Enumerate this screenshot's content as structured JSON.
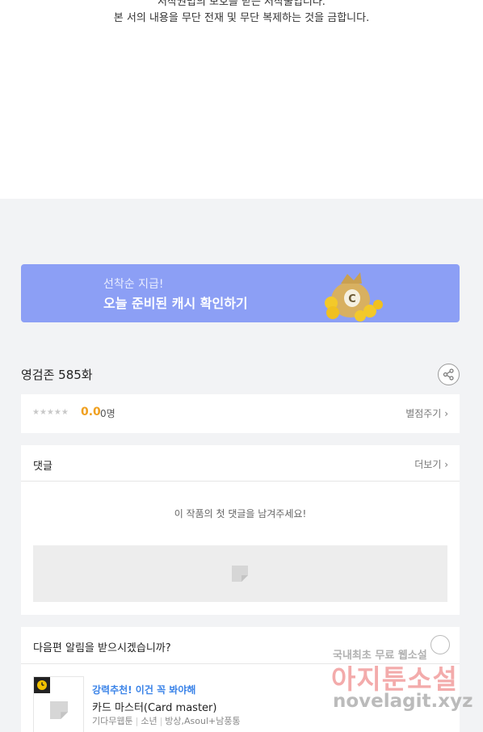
{
  "copyright": {
    "line1": "저작권법의 보호를 받는 저작물입니다.",
    "line2": "본 서의 내용을 무단 전재 및 무단 복제하는 것을 금합니다."
  },
  "banner": {
    "subtitle": "선착순 지급!",
    "title": "오늘 준비된 캐시 확인하기",
    "coin_letter": "C",
    "bg_color": "#8c9ff5"
  },
  "episode": {
    "title": "영검존 585화",
    "share_icon": "share-icon"
  },
  "rating": {
    "stars": "★★★★★",
    "star_count": 5,
    "filled_stars": 0,
    "score": "0.0",
    "count": "0명",
    "rate_link": "별점주기"
  },
  "comments": {
    "header": "댓글",
    "more": "더보기",
    "empty_message": "이 작품의 첫 댓글을 남겨주세요!"
  },
  "next_episode": {
    "question": "다음편 알림을 받으시겠습니까?",
    "bell_icon": "bell-icon"
  },
  "recommendation": {
    "label": "강력추천! 이건 꼭 봐야해",
    "title": "카드 마스터(Card master)",
    "meta": [
      "기다무웹툰",
      "소년",
      "방상,Asoul+남풍통"
    ]
  },
  "watermark": {
    "line1": "국내최초 무료 웹소설",
    "line2": "아지툰소설",
    "line3": "novelagit.xyz"
  },
  "colors": {
    "accent_orange": "#f0a020",
    "link_blue": "#3a83e8",
    "page_bg": "#f2f3f5"
  }
}
